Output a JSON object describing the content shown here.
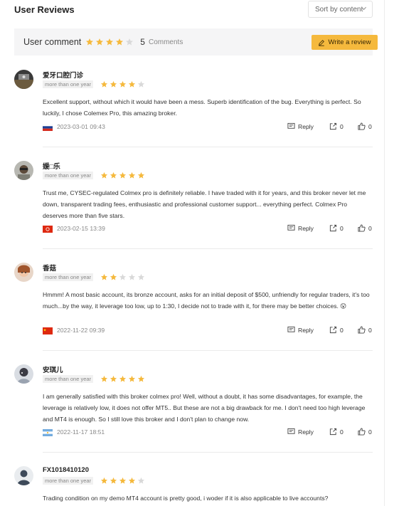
{
  "header": {
    "title": "User Reviews",
    "sort_label": "Sort by content"
  },
  "summary": {
    "label": "User comment",
    "rating": 4,
    "count": "5",
    "count_label": "Comments",
    "write_button": "Write a review"
  },
  "colors": {
    "star_filled": "#f5b93d",
    "star_empty": "#d9d9d9",
    "write_button_bg": "#f5b93d"
  },
  "reviews": [
    {
      "name": "爱牙口腔门诊",
      "tenure": "more than one year",
      "rating": 4,
      "text": "Excellent support, without which it would have been a mess. Superb identification of the bug. Everything is perfect. So luckily, I chose Colemex Pro, this amazing broker.",
      "flag": "russia",
      "date": "2023-03-01 09:43",
      "reply_label": "Reply",
      "shares": "0",
      "likes": "0"
    },
    {
      "name": "媛□乐",
      "tenure": "more than one year",
      "rating": 5,
      "text": "Trust me, CYSEC-regulated Colmex pro is definitely reliable. I have traded with it for years, and this broker never let me down, transparent trading fees, enthusiastic and professional customer support... everything perfect. Colmex Pro deserves more than five stars.",
      "flag": "hong-kong",
      "date": "2023-02-15 13:39",
      "reply_label": "Reply",
      "shares": "0",
      "likes": "0"
    },
    {
      "name": "香菇",
      "tenure": "more than one year",
      "rating": 2,
      "text": "Hmmm! A most basic account, its bronze account, asks for an initial deposit of $500, unfriendly for regular traders, it's too much...by the way, it leverage too low, up to 1:30, I decide not to trade with it, for there may be better choices. 😮",
      "flag": "china",
      "date": "2022-11-22 09:39",
      "reply_label": "Reply",
      "shares": "0",
      "likes": "0"
    },
    {
      "name": "安琪儿",
      "tenure": "more than one year",
      "rating": 5,
      "text": "I am generally satisfied with this broker colmex pro! Well, without a doubt, it has some disadvantages, for example, the leverage is relatively low, it does not offer MT5.. But these are not a big drawback for me. I don't need too high leverage and MT4 is enough. So I still love this broker and I don't plan to change now.",
      "flag": "argentina",
      "date": "2022-11-17 18:51",
      "reply_label": "Reply",
      "shares": "0",
      "likes": "0"
    },
    {
      "name": "FX1018410120",
      "tenure": "more than one year",
      "rating": 4,
      "text": "Trading condition on my demo MT4 account is pretty good, i woder if it is also applicable to live accounts?",
      "flag": "",
      "date": "",
      "reply_label": "Reply",
      "shares": "",
      "likes": ""
    }
  ]
}
